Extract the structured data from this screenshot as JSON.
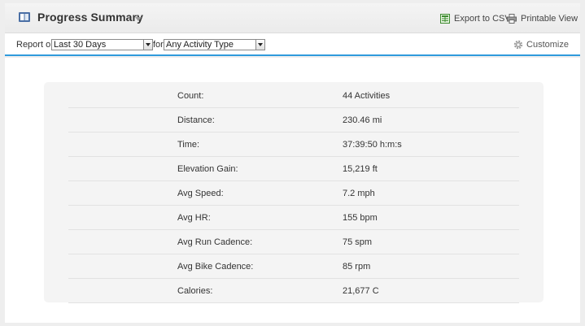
{
  "header": {
    "title": "Progress Summary",
    "export_label": "Export to CSV",
    "printable_label": "Printable View"
  },
  "filters": {
    "report_on_label": "Report on",
    "date_range_value": "Last 30 Days",
    "for_label": "for",
    "activity_type_value": "Any Activity Type",
    "customize_label": "Customize"
  },
  "colors": {
    "accent_line": "#2f9bdc",
    "panel_bg": "#f4f4f4"
  },
  "summary": {
    "rows": [
      {
        "label": "Count:",
        "value": "44 Activities"
      },
      {
        "label": "Distance:",
        "value": "230.46 mi"
      },
      {
        "label": "Time:",
        "value": "37:39:50 h:m:s"
      },
      {
        "label": "Elevation Gain:",
        "value": "15,219 ft"
      },
      {
        "label": "Avg Speed:",
        "value": "7.2 mph"
      },
      {
        "label": "Avg HR:",
        "value": "155 bpm"
      },
      {
        "label": "Avg Run Cadence:",
        "value": "75 spm"
      },
      {
        "label": "Avg Bike Cadence:",
        "value": "85 rpm"
      },
      {
        "label": "Calories:",
        "value": "21,677 C"
      }
    ]
  },
  "icons": {
    "title": "book-icon",
    "export": "spreadsheet-icon",
    "print": "printer-icon",
    "customize": "gear-icon"
  }
}
